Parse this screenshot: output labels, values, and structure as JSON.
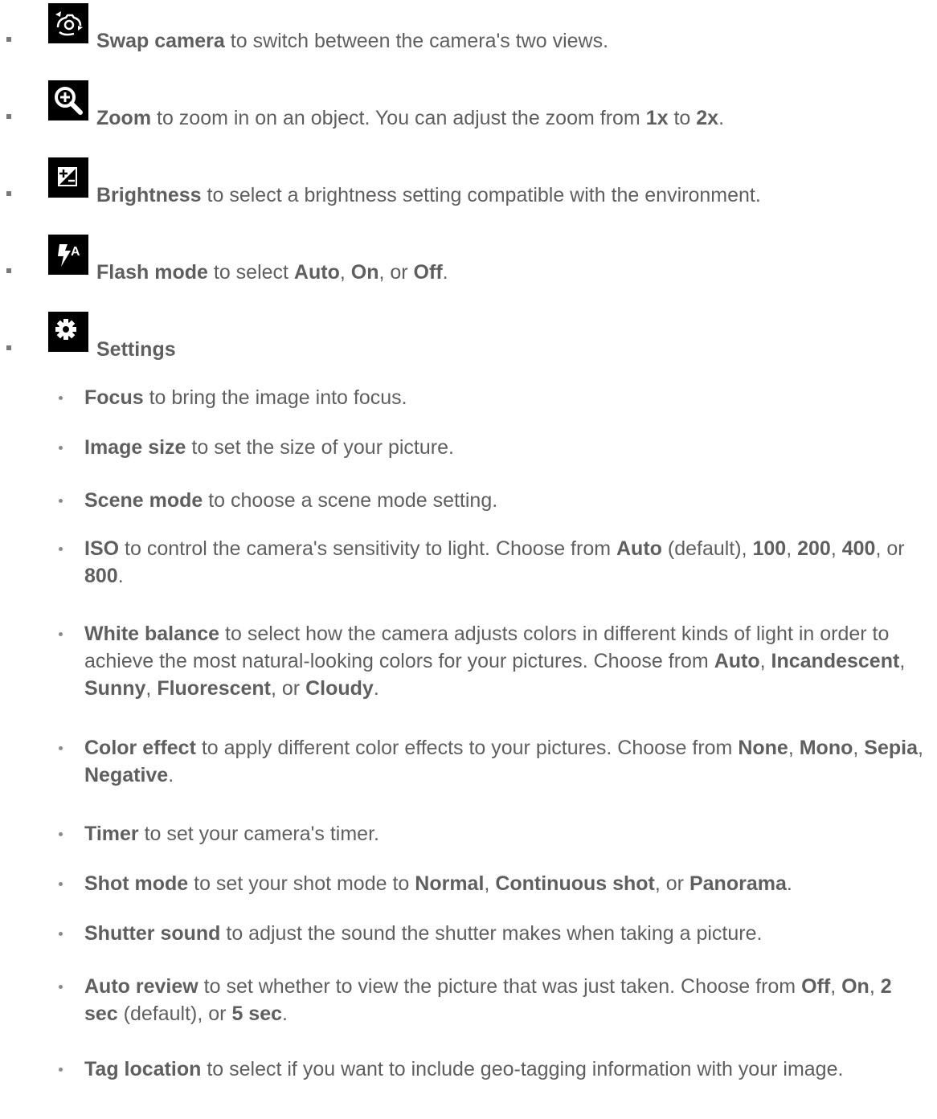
{
  "items": [
    {
      "icon": "swap-camera-icon",
      "label": "Swap camera",
      "text": " to switch between the camera's two views."
    },
    {
      "icon": "zoom-icon",
      "label": "Zoom",
      "text_1": " to zoom in on an object. You can adjust the zoom from ",
      "v1": "1x",
      "text_2": " to ",
      "v2": "2x",
      "text_3": "."
    },
    {
      "icon": "brightness-icon",
      "label": "Brightness",
      "text": " to select a brightness setting compatible with the environment."
    },
    {
      "icon": "flash-mode-icon",
      "label": "Flash mode",
      "text_1": " to select ",
      "o1": "Auto",
      "sep1": ", ",
      "o2": "On",
      "sep2": ", or ",
      "o3": "Off",
      "end": "."
    },
    {
      "icon": "settings-icon",
      "label": "Settings"
    }
  ],
  "settings": [
    {
      "label": "Focus",
      "text": " to bring the image into focus."
    },
    {
      "label": "Image size",
      "text": " to set the size of your picture."
    },
    {
      "label": "Scene mode",
      "text": " to choose a scene mode setting."
    },
    {
      "label": "ISO",
      "text_1": " to control the camera's sensitivity to light. Choose from ",
      "o1": "Auto",
      "t1": " (default), ",
      "o2": "100",
      "t2": ", ",
      "o3": "200",
      "t3": ", ",
      "o4": "400",
      "t4": ", or ",
      "o5": "800",
      "end": "."
    },
    {
      "label": "White balance",
      "text_1": " to select how the camera adjusts colors in different kinds of light in order to achieve the most natural-looking colors for your pictures. Choose from ",
      "o1": "Auto",
      "t1": ", ",
      "o2": "Incandescent",
      "t2": ", ",
      "o3": "Sunny",
      "t3": ", ",
      "o4": "Fluorescent",
      "t4": ", or ",
      "o5": "Cloudy",
      "end": "."
    },
    {
      "label": "Color effect",
      "text_1": " to apply different color effects to your pictures. Choose from ",
      "o1": "None",
      "t1": ", ",
      "o2": "Mono",
      "t2": ", ",
      "o3": "Sepia",
      "t3": ", ",
      "o4": "Negative",
      "end": "."
    },
    {
      "label": "Timer",
      "text": " to set your camera's timer."
    },
    {
      "label": "Shot mode",
      "text_1": " to set your shot mode to ",
      "o1": "Normal",
      "t1": ", ",
      "o2": "Continuous shot",
      "t2": ", or ",
      "o3": "Panorama",
      "end": "."
    },
    {
      "label": "Shutter sound",
      "text": " to adjust the sound the shutter makes when taking a picture."
    },
    {
      "label": "Auto review",
      "text_1": " to set whether to view the picture that was just taken. Choose from ",
      "o1": "Off",
      "t1": ", ",
      "o2": "On",
      "t2": ", ",
      "o3": "2 sec",
      "t3": " (default), or ",
      "o4": "5 sec",
      "end": "."
    },
    {
      "label": "Tag location",
      "text": " to select if you want to include geo-tagging information with your image."
    }
  ]
}
